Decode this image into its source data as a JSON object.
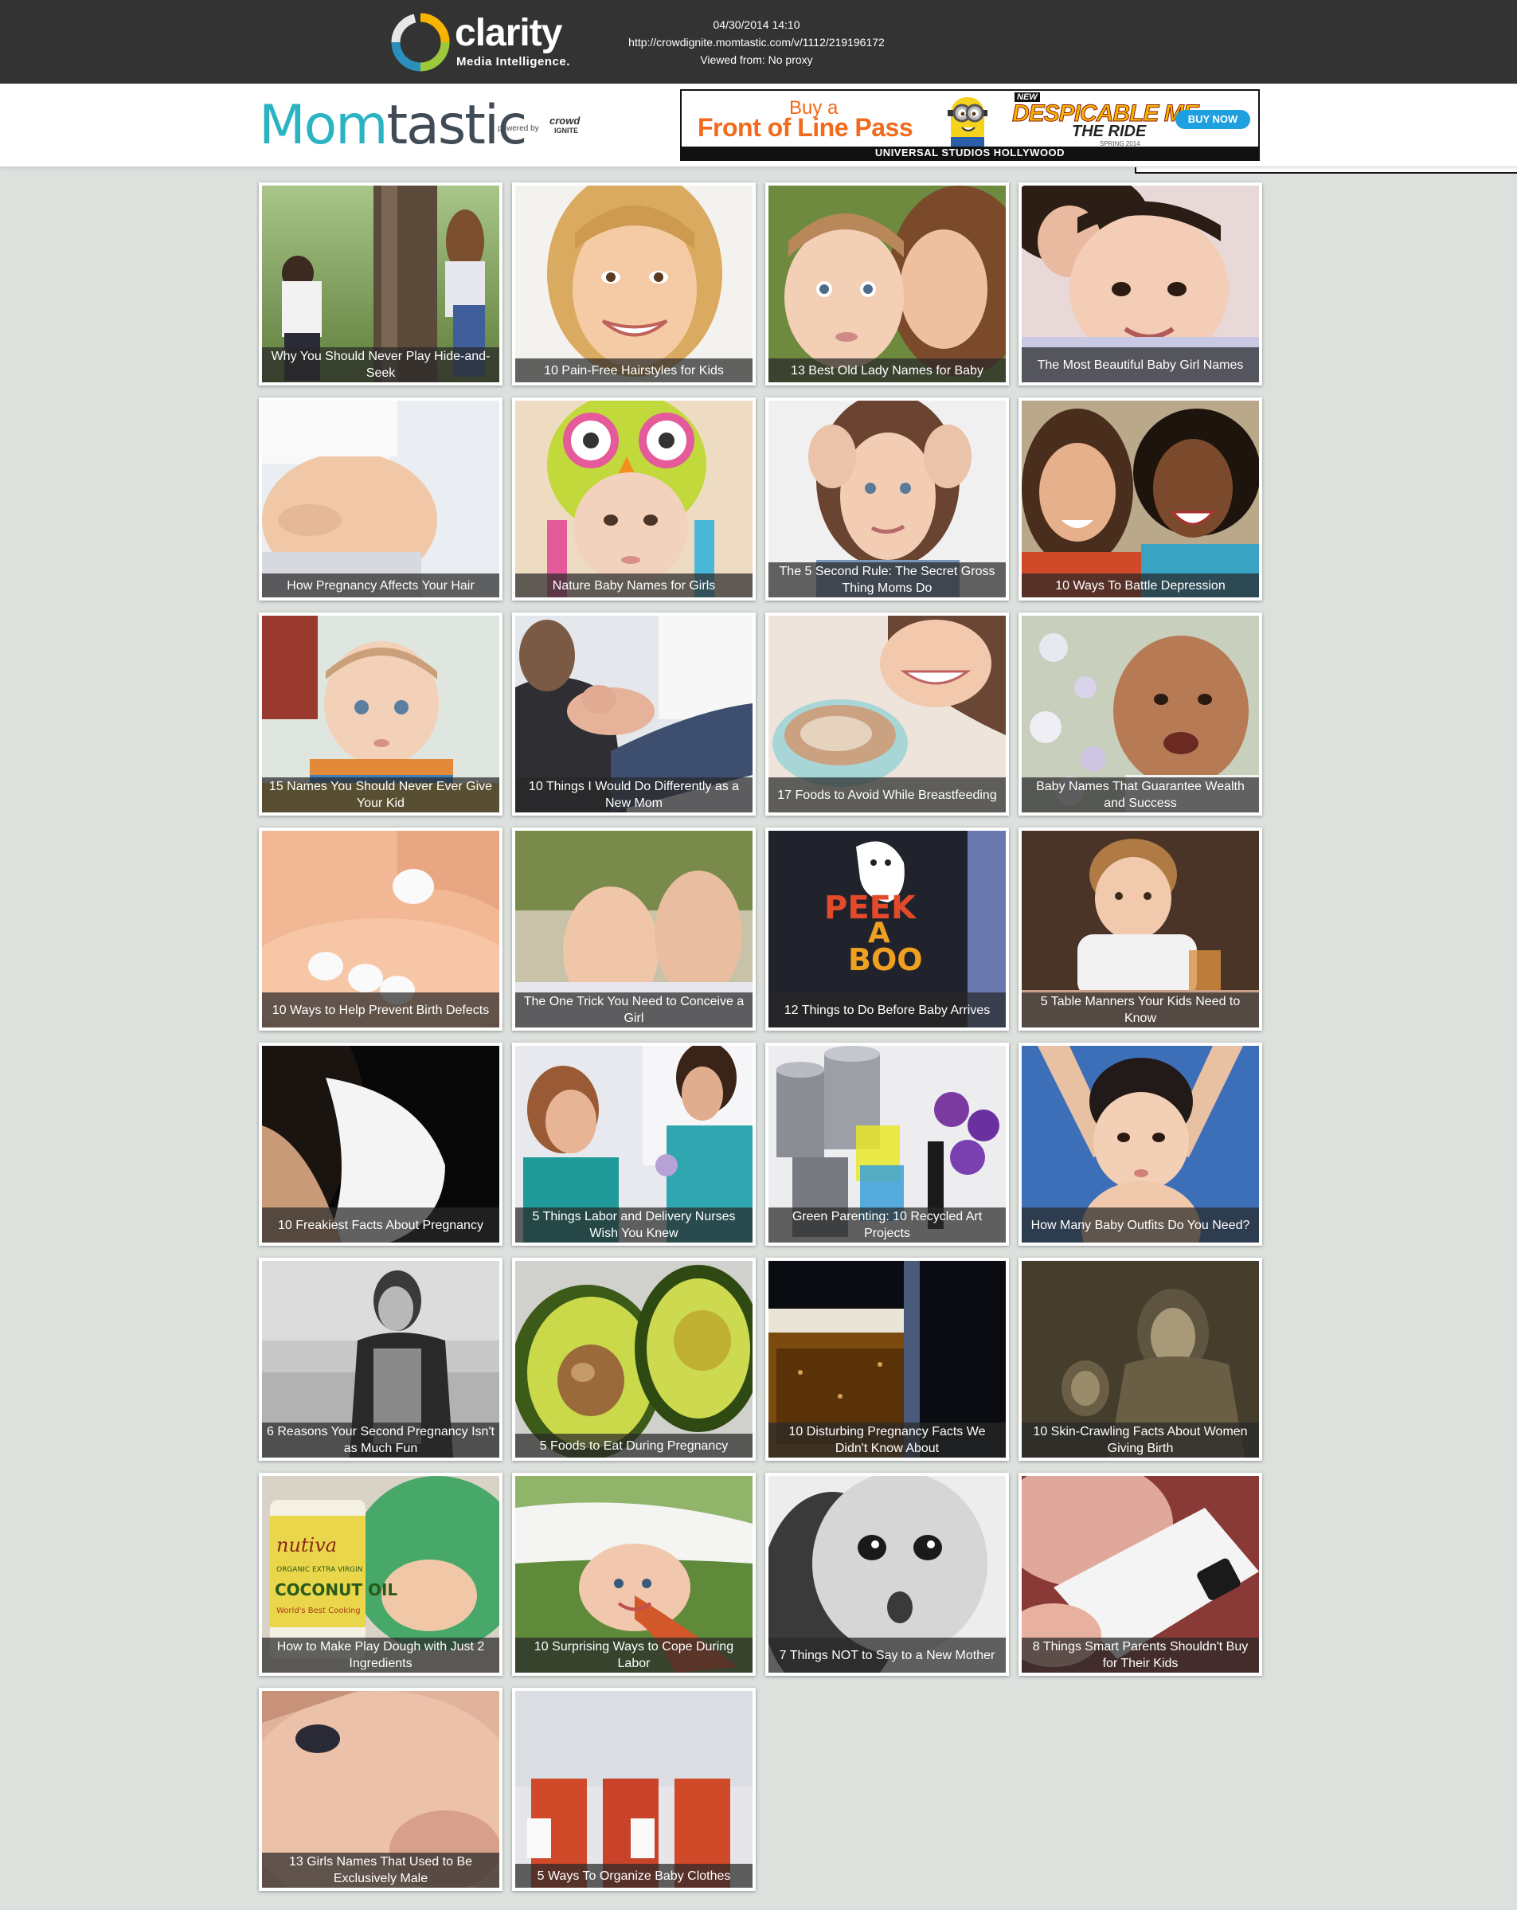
{
  "adclarity": {
    "brand_ad": "ad",
    "brand_rest": "clarity",
    "tagline": "Media Intelligence.",
    "date": "04/30/2014 14:10",
    "url": "http://crowdignite.momtastic.com/v/1112/219196172",
    "viewed_from": "Viewed from: No proxy"
  },
  "site": {
    "logo_mom": "Mom",
    "logo_tastic": "tastic",
    "powered_by": "powered by",
    "crowd": "crowd",
    "ignite": "IGNITE"
  },
  "ad_banner": {
    "buy": "Buy a",
    "front_of_line": "Front of Line Pass",
    "new": "NEW",
    "title": "DESPICABLE ME",
    "the_ride": "THE RIDE",
    "spring": "SPRING 2014",
    "button": "BUY NOW",
    "strip": "UNIVERSAL STUDIOS HOLLYWOOD"
  },
  "articles": [
    {
      "title": "Why You Should Never Play Hide-and-Seek",
      "icon": "photo-mother-child-tree"
    },
    {
      "title": "10 Pain-Free Hairstyles for Kids",
      "icon": "photo-smiling-girl"
    },
    {
      "title": "13 Best Old Lady Names for Baby",
      "icon": "photo-mother-baby"
    },
    {
      "title": "The Most Beautiful Baby Girl Names",
      "icon": "photo-baby-girl"
    },
    {
      "title": "How Pregnancy Affects Your Hair",
      "icon": "photo-pregnant-belly"
    },
    {
      "title": "Nature Baby Names for Girls",
      "icon": "photo-baby-owl-hat"
    },
    {
      "title": "The 5 Second Rule: The Secret Gross Thing Moms Do",
      "icon": "photo-thinking-woman"
    },
    {
      "title": "10 Ways To Battle Depression",
      "icon": "photo-laughing-women"
    },
    {
      "title": "15 Names You Should Never Ever Give Your Kid",
      "icon": "photo-baby-boy"
    },
    {
      "title": "10 Things I Would Do Differently as a New Mom",
      "icon": "photo-newborn"
    },
    {
      "title": "17 Foods to Avoid While Breastfeeding",
      "icon": "photo-coffee-cup"
    },
    {
      "title": "Baby Names That Guarantee Wealth and Success",
      "icon": "photo-smiling-baby"
    },
    {
      "title": "10 Ways to Help Prevent Birth Defects",
      "icon": "photo-pills"
    },
    {
      "title": "The One Trick You Need to Conceive a Girl",
      "icon": "photo-feet"
    },
    {
      "title": "12 Things to Do Before Baby Arrives",
      "icon": "photo-peekaboo-shirt"
    },
    {
      "title": "5 Table Manners Your Kids Need to Know",
      "icon": "photo-toddler-table"
    },
    {
      "title": "10 Freakiest Facts About Pregnancy",
      "icon": "photo-pregnant-profile"
    },
    {
      "title": "5 Things Labor and Delivery Nurses Wish You Knew",
      "icon": "photo-nurses"
    },
    {
      "title": "Green Parenting: 10 Recycled Art Projects",
      "icon": "photo-tin-cans"
    },
    {
      "title": "How Many Baby Outfits Do You Need?",
      "icon": "photo-baby-arms-up"
    },
    {
      "title": "6 Reasons Your Second Pregnancy Isn't as Much Fun",
      "icon": "photo-woman-beach"
    },
    {
      "title": "5 Foods to Eat During Pregnancy",
      "icon": "photo-avocado"
    },
    {
      "title": "10 Disturbing Pregnancy Facts We Didn't Know About",
      "icon": "photo-beer"
    },
    {
      "title": "10 Skin-Crawling Facts About Women Giving Birth",
      "icon": "photo-engraving"
    },
    {
      "title": "How to Make Play Dough with Just 2 Ingredients",
      "icon": "photo-coconut-oil"
    },
    {
      "title": "10 Surprising Ways to Cope During Labor",
      "icon": "photo-woman-grass"
    },
    {
      "title": "7 Things NOT to Say to a New Mother",
      "icon": "photo-surprised-baby"
    },
    {
      "title": "8 Things Smart Parents Shouldn't Buy for Their Kids",
      "icon": "photo-remote"
    },
    {
      "title": "13 Girls Names That Used to Be Exclusively Male",
      "icon": "photo-baby-face"
    },
    {
      "title": "5 Ways To Organize Baby Clothes",
      "icon": "photo-storage-bins"
    }
  ],
  "coconut_jar": {
    "brand": "nutiva",
    "line1": "ORGANIC EXTRA VIRGIN",
    "line2": "COCONUT OIL",
    "line3": "World's Best Cooking"
  },
  "peekaboo": {
    "line1": "PEEK",
    "line2": "A",
    "line3": "BOO"
  }
}
